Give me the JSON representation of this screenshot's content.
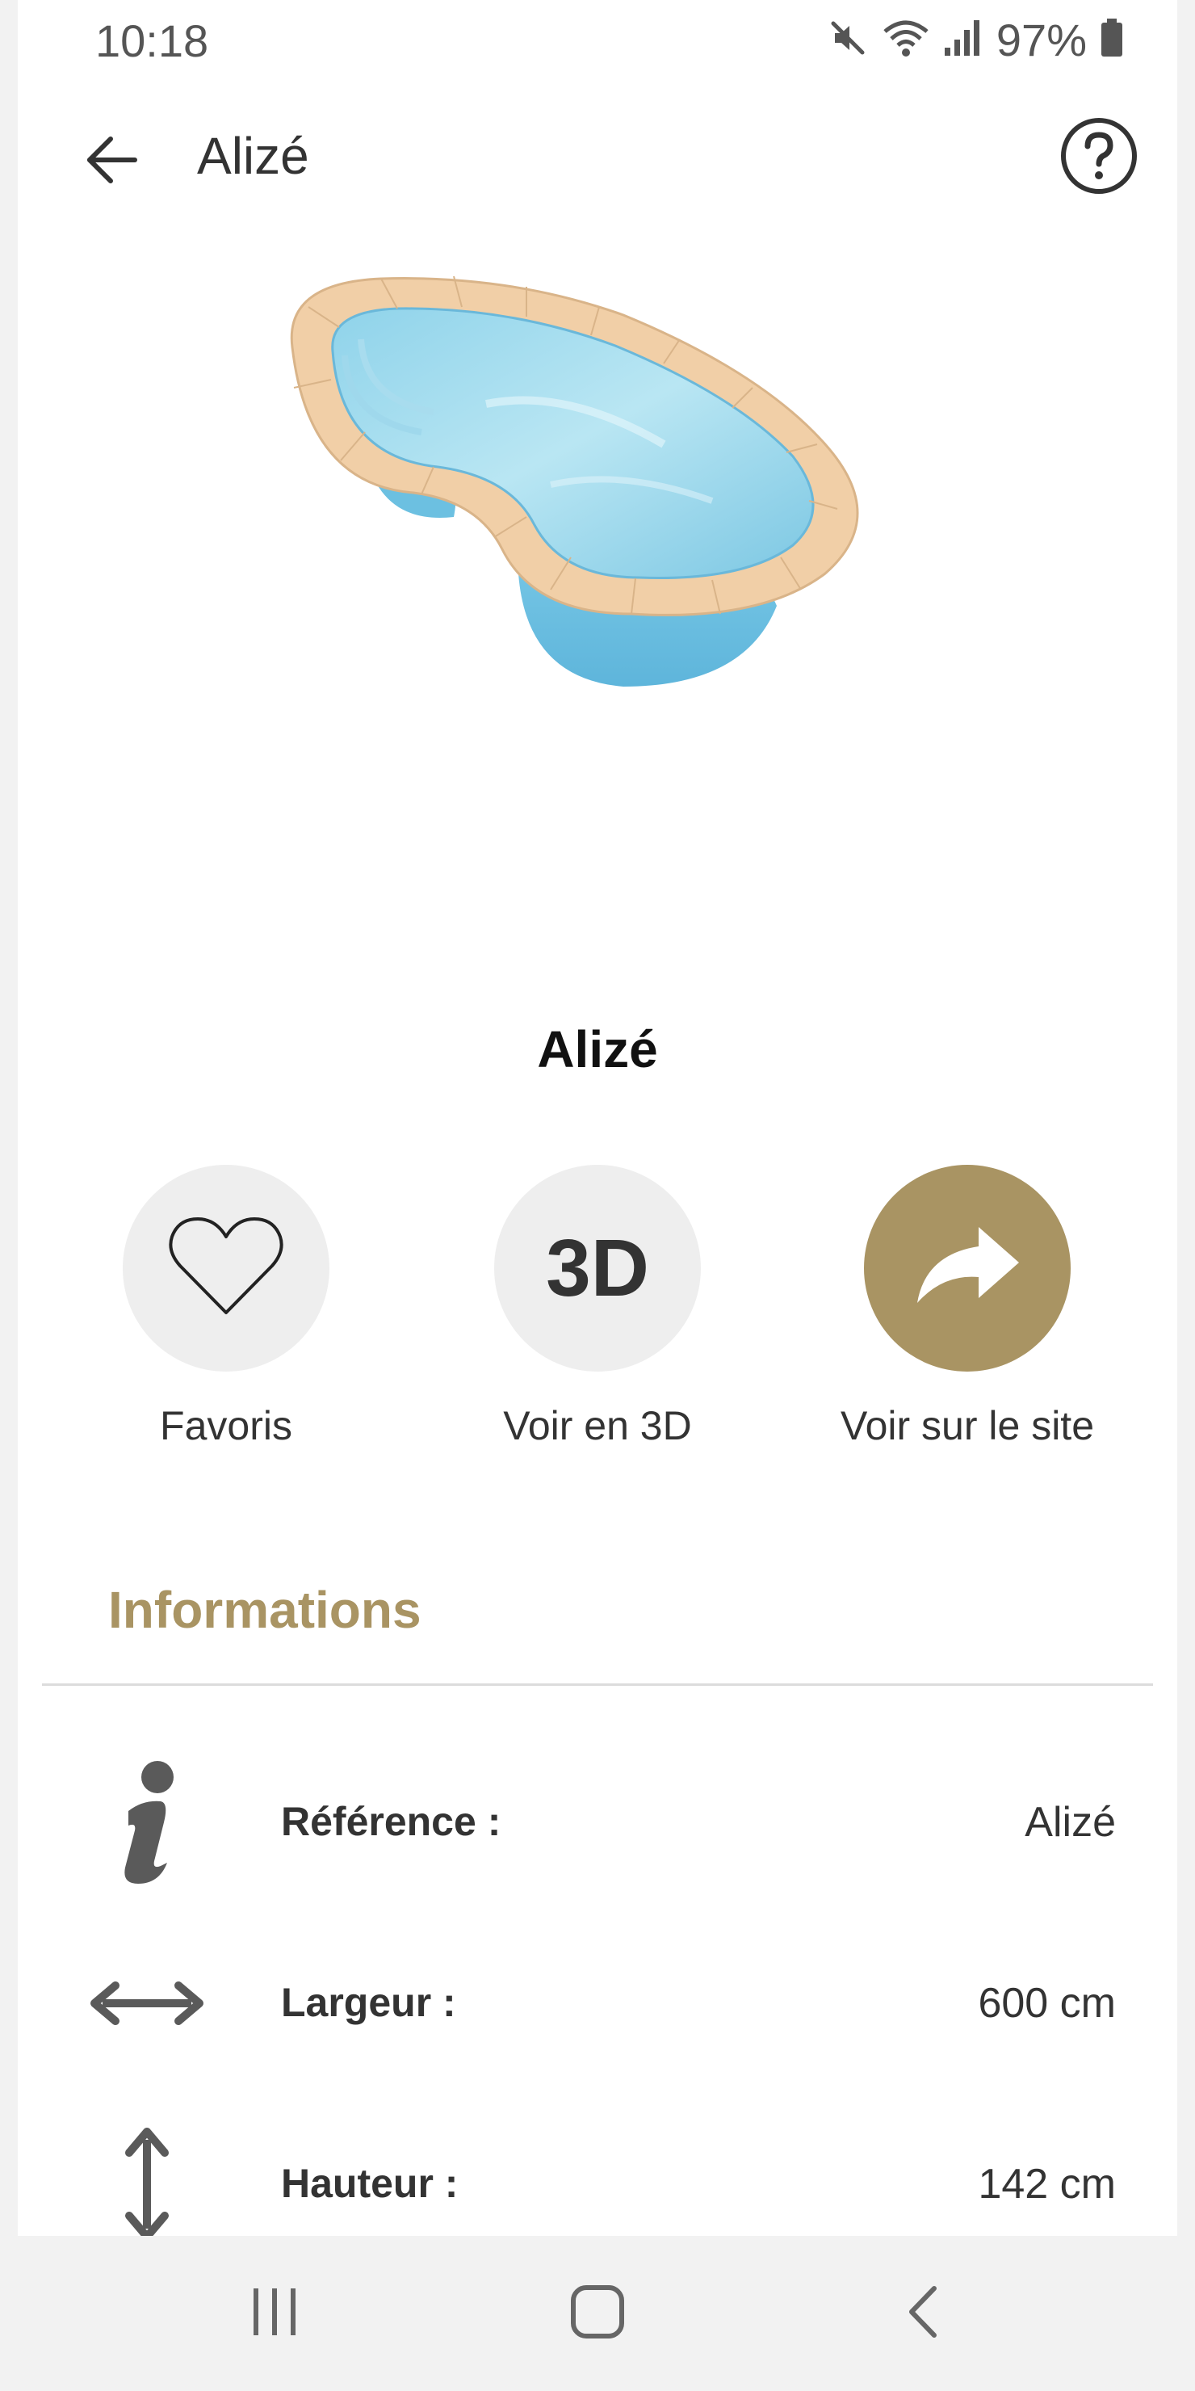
{
  "status_bar": {
    "time": "10:18",
    "battery": "97%",
    "icons": [
      "mute-icon",
      "wifi-icon",
      "signal-icon",
      "battery-icon"
    ]
  },
  "app_bar": {
    "title": "Alizé",
    "back_icon": "arrow-left-icon",
    "help_icon": "help-circle-icon"
  },
  "product": {
    "name": "Alizé"
  },
  "actions": {
    "favoris_label": "Favoris",
    "voir3d_label": "Voir en 3D",
    "voir3d_text": "3D",
    "site_label": "Voir sur le site"
  },
  "informations": {
    "title": "Informations",
    "rows": [
      {
        "icon": "info-icon",
        "label": "Référence :",
        "value": "Alizé"
      },
      {
        "icon": "width-arrows-icon",
        "label": "Largeur :",
        "value": "600 cm"
      },
      {
        "icon": "height-arrows-icon",
        "label": "Hauteur :",
        "value": "142 cm"
      }
    ]
  },
  "colors": {
    "accent": "#a99463",
    "button_bg": "#eeeeee",
    "icon": "#5a5a5a"
  },
  "nav_bar": {
    "icons": [
      "recent-apps-icon",
      "home-icon",
      "back-icon"
    ]
  }
}
